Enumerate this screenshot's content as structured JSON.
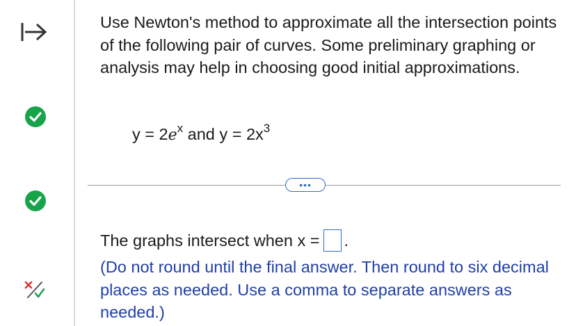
{
  "question": {
    "prompt": "Use Newton's method to approximate all the intersection points of the following pair of curves. Some preliminary graphing or analysis may help in choosing good initial approximations.",
    "equation": {
      "lhs1": "y = 2",
      "base1": "e",
      "exp1": "x",
      "conj": " and ",
      "lhs2": "y = 2x",
      "exp2": "3"
    }
  },
  "divider": {
    "more_label": "•••"
  },
  "answer": {
    "label": "The graphs intersect when x =",
    "value": "",
    "suffix": ".",
    "instructions": "(Do not round until the final answer. Then round to six decimal places as needed. Use a comma to separate answers as needed.)"
  },
  "rail": {
    "icons": [
      "expand-icon",
      "check-circle-icon",
      "check-circle-icon",
      "partial-credit-icon"
    ],
    "colors": {
      "check": "#17a34a",
      "link": "#2f6bd1",
      "text_blue": "#1f3fa8"
    }
  }
}
